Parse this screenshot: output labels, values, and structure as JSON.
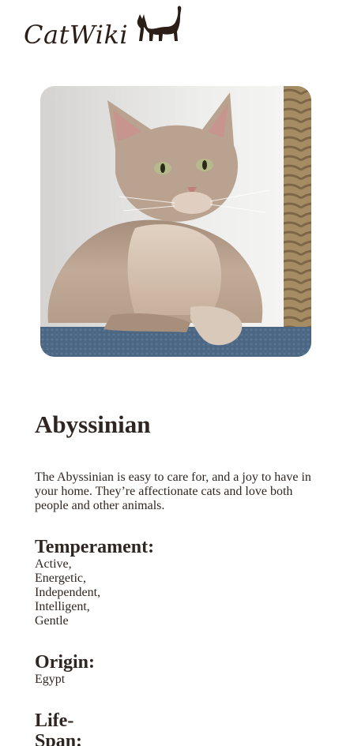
{
  "header": {
    "logo_text": "CatWiki",
    "logo_icon": "cat-silhouette-icon"
  },
  "hero": {
    "image": "abyssinian-cat-photo",
    "alt": "Abyssinian"
  },
  "breed": {
    "name": "Abyssinian",
    "description": "The Abyssinian is easy to care for, and a joy to have in your home. They’re affectionate cats and love both people and other animals.",
    "temperament_label": "Temperament:",
    "temperament": [
      "Active,",
      "Energetic,",
      "Independent,",
      "Intelligent,",
      "Gentle"
    ],
    "origin_label": "Origin:",
    "origin": "Egypt",
    "lifespan_label": "Life-Span:"
  },
  "colors": {
    "text": "#2f2622",
    "logo": "#2b1e17"
  }
}
